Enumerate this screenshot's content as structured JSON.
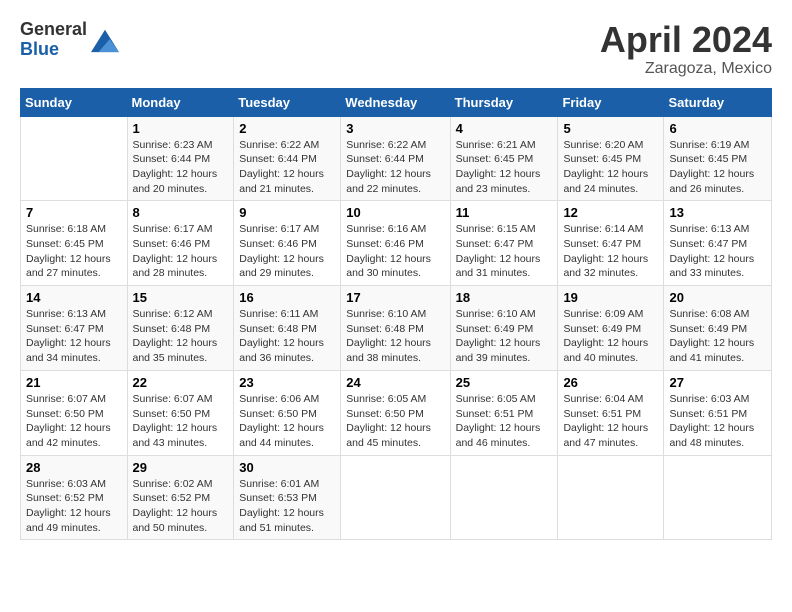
{
  "header": {
    "logo_general": "General",
    "logo_blue": "Blue",
    "month_title": "April 2024",
    "location": "Zaragoza, Mexico"
  },
  "weekdays": [
    "Sunday",
    "Monday",
    "Tuesday",
    "Wednesday",
    "Thursday",
    "Friday",
    "Saturday"
  ],
  "weeks": [
    [
      {
        "day": "",
        "info": ""
      },
      {
        "day": "1",
        "info": "Sunrise: 6:23 AM\nSunset: 6:44 PM\nDaylight: 12 hours\nand 20 minutes."
      },
      {
        "day": "2",
        "info": "Sunrise: 6:22 AM\nSunset: 6:44 PM\nDaylight: 12 hours\nand 21 minutes."
      },
      {
        "day": "3",
        "info": "Sunrise: 6:22 AM\nSunset: 6:44 PM\nDaylight: 12 hours\nand 22 minutes."
      },
      {
        "day": "4",
        "info": "Sunrise: 6:21 AM\nSunset: 6:45 PM\nDaylight: 12 hours\nand 23 minutes."
      },
      {
        "day": "5",
        "info": "Sunrise: 6:20 AM\nSunset: 6:45 PM\nDaylight: 12 hours\nand 24 minutes."
      },
      {
        "day": "6",
        "info": "Sunrise: 6:19 AM\nSunset: 6:45 PM\nDaylight: 12 hours\nand 26 minutes."
      }
    ],
    [
      {
        "day": "7",
        "info": "Sunrise: 6:18 AM\nSunset: 6:45 PM\nDaylight: 12 hours\nand 27 minutes."
      },
      {
        "day": "8",
        "info": "Sunrise: 6:17 AM\nSunset: 6:46 PM\nDaylight: 12 hours\nand 28 minutes."
      },
      {
        "day": "9",
        "info": "Sunrise: 6:17 AM\nSunset: 6:46 PM\nDaylight: 12 hours\nand 29 minutes."
      },
      {
        "day": "10",
        "info": "Sunrise: 6:16 AM\nSunset: 6:46 PM\nDaylight: 12 hours\nand 30 minutes."
      },
      {
        "day": "11",
        "info": "Sunrise: 6:15 AM\nSunset: 6:47 PM\nDaylight: 12 hours\nand 31 minutes."
      },
      {
        "day": "12",
        "info": "Sunrise: 6:14 AM\nSunset: 6:47 PM\nDaylight: 12 hours\nand 32 minutes."
      },
      {
        "day": "13",
        "info": "Sunrise: 6:13 AM\nSunset: 6:47 PM\nDaylight: 12 hours\nand 33 minutes."
      }
    ],
    [
      {
        "day": "14",
        "info": "Sunrise: 6:13 AM\nSunset: 6:47 PM\nDaylight: 12 hours\nand 34 minutes."
      },
      {
        "day": "15",
        "info": "Sunrise: 6:12 AM\nSunset: 6:48 PM\nDaylight: 12 hours\nand 35 minutes."
      },
      {
        "day": "16",
        "info": "Sunrise: 6:11 AM\nSunset: 6:48 PM\nDaylight: 12 hours\nand 36 minutes."
      },
      {
        "day": "17",
        "info": "Sunrise: 6:10 AM\nSunset: 6:48 PM\nDaylight: 12 hours\nand 38 minutes."
      },
      {
        "day": "18",
        "info": "Sunrise: 6:10 AM\nSunset: 6:49 PM\nDaylight: 12 hours\nand 39 minutes."
      },
      {
        "day": "19",
        "info": "Sunrise: 6:09 AM\nSunset: 6:49 PM\nDaylight: 12 hours\nand 40 minutes."
      },
      {
        "day": "20",
        "info": "Sunrise: 6:08 AM\nSunset: 6:49 PM\nDaylight: 12 hours\nand 41 minutes."
      }
    ],
    [
      {
        "day": "21",
        "info": "Sunrise: 6:07 AM\nSunset: 6:50 PM\nDaylight: 12 hours\nand 42 minutes."
      },
      {
        "day": "22",
        "info": "Sunrise: 6:07 AM\nSunset: 6:50 PM\nDaylight: 12 hours\nand 43 minutes."
      },
      {
        "day": "23",
        "info": "Sunrise: 6:06 AM\nSunset: 6:50 PM\nDaylight: 12 hours\nand 44 minutes."
      },
      {
        "day": "24",
        "info": "Sunrise: 6:05 AM\nSunset: 6:50 PM\nDaylight: 12 hours\nand 45 minutes."
      },
      {
        "day": "25",
        "info": "Sunrise: 6:05 AM\nSunset: 6:51 PM\nDaylight: 12 hours\nand 46 minutes."
      },
      {
        "day": "26",
        "info": "Sunrise: 6:04 AM\nSunset: 6:51 PM\nDaylight: 12 hours\nand 47 minutes."
      },
      {
        "day": "27",
        "info": "Sunrise: 6:03 AM\nSunset: 6:51 PM\nDaylight: 12 hours\nand 48 minutes."
      }
    ],
    [
      {
        "day": "28",
        "info": "Sunrise: 6:03 AM\nSunset: 6:52 PM\nDaylight: 12 hours\nand 49 minutes."
      },
      {
        "day": "29",
        "info": "Sunrise: 6:02 AM\nSunset: 6:52 PM\nDaylight: 12 hours\nand 50 minutes."
      },
      {
        "day": "30",
        "info": "Sunrise: 6:01 AM\nSunset: 6:53 PM\nDaylight: 12 hours\nand 51 minutes."
      },
      {
        "day": "",
        "info": ""
      },
      {
        "day": "",
        "info": ""
      },
      {
        "day": "",
        "info": ""
      },
      {
        "day": "",
        "info": ""
      }
    ]
  ]
}
